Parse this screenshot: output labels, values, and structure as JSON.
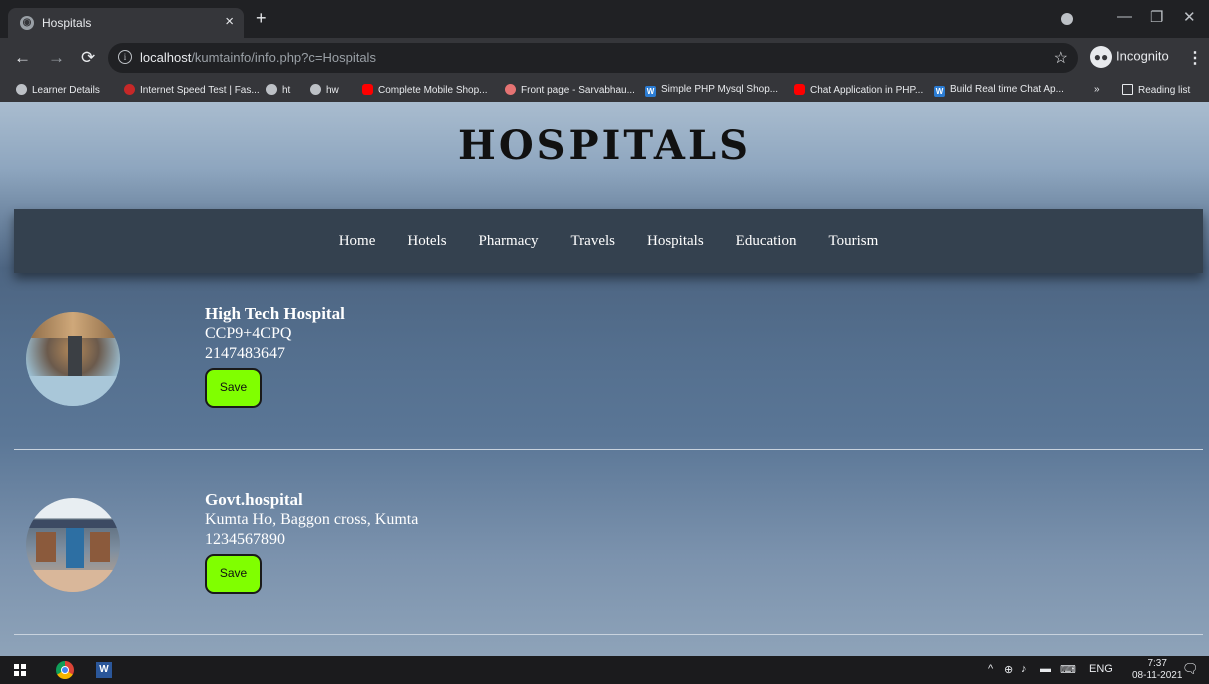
{
  "browser": {
    "tab_title": "Hospitals",
    "tab_close": "×",
    "new_tab": "+",
    "url_host": "localhost",
    "url_path": "/kumtainfo/info.php?c=Hospitals",
    "profile_label": "Incognito",
    "bookmarks": [
      {
        "label": "Learner Details",
        "icon": "globe-icon"
      },
      {
        "label": "Internet Speed Test | Fas...",
        "icon": "speed-icon"
      },
      {
        "label": "ht",
        "icon": "globe-icon"
      },
      {
        "label": "hw",
        "icon": "globe-icon"
      },
      {
        "label": "Complete Mobile Shop...",
        "icon": "youtube-icon"
      },
      {
        "label": "Front page - Sarvabhau...",
        "icon": "site-icon"
      },
      {
        "label": "Simple PHP Mysql Shop...",
        "icon": "word-icon"
      },
      {
        "label": "Chat Application in PHP...",
        "icon": "youtube-icon"
      },
      {
        "label": "Build Real time Chat Ap...",
        "icon": "word-icon"
      }
    ],
    "overflow": "»",
    "reading_list": "Reading list"
  },
  "page": {
    "title": "HOSPITALS",
    "nav": [
      "Home",
      "Hotels",
      "Pharmacy",
      "Travels",
      "Hospitals",
      "Education",
      "Tourism"
    ],
    "entries": [
      {
        "name": "High Tech Hospital",
        "address": "CCP9+4CPQ",
        "phone": "2147483647",
        "save_label": "Save"
      },
      {
        "name": "Govt.hospital",
        "address": "Kumta Ho, Baggon cross, Kumta",
        "phone": "1234567890",
        "save_label": "Save"
      }
    ]
  },
  "taskbar": {
    "language": "ENG",
    "time": "7:37",
    "date": "08-11-2021"
  }
}
